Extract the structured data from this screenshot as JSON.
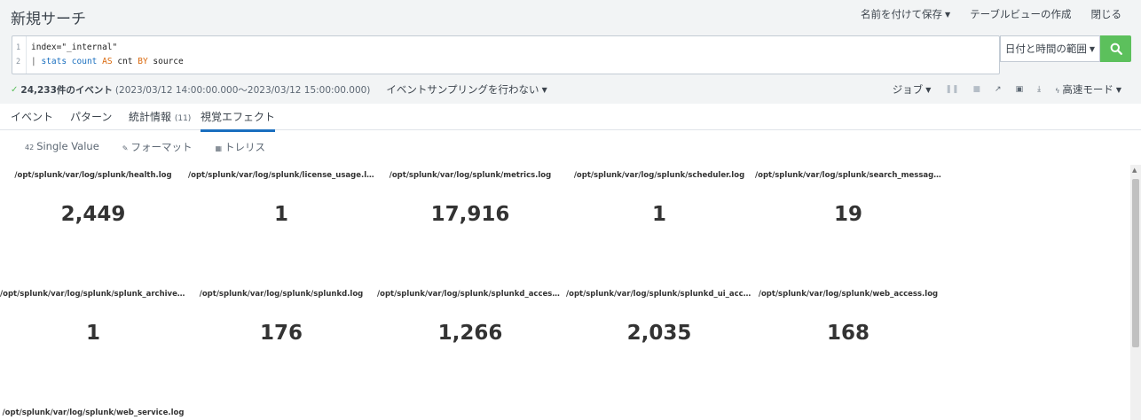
{
  "header": {
    "title": "新規サーチ",
    "save_as": "名前を付けて保存",
    "table_view": "テーブルビューの作成",
    "close": "閉じる"
  },
  "search": {
    "line1_no": "1",
    "line2_no": "2",
    "line1_text": "index=\"_internal\"",
    "line2_pipe": "| ",
    "line2_stats": "stats",
    "line2_count": "count",
    "line2_as": "AS",
    "line2_cnt": "cnt",
    "line2_by": "BY",
    "line2_source": "source",
    "time_range_label": "日付と時間の範囲"
  },
  "status": {
    "event_count": "24,233件のイベント",
    "time_range": "(2023/03/12 14:00:00.000～2023/03/12 15:00:00.000)",
    "sampling": "イベントサンプリングを行わない",
    "job": "ジョブ",
    "mode": "高速モード"
  },
  "tabs": {
    "events": "イベント",
    "patterns": "パターン",
    "statistics": "統計情報",
    "statistics_count": "(11)",
    "visualization": "視覚エフェクト"
  },
  "viz_toolbar": {
    "single_value": "Single Value",
    "format": "フォーマット",
    "trellis": "トレリス"
  },
  "trellis": [
    {
      "label": "/opt/splunk/var/log/splunk/health.log",
      "value": "2,449"
    },
    {
      "label": "/opt/splunk/var/log/splunk/license_usage.log",
      "value": "1"
    },
    {
      "label": "/opt/splunk/var/log/splunk/metrics.log",
      "value": "17,916"
    },
    {
      "label": "/opt/splunk/var/log/splunk/scheduler.log",
      "value": "1"
    },
    {
      "label": "/opt/splunk/var/log/splunk/search_message...",
      "value": "19"
    },
    {
      "label": "/opt/splunk/var/log/splunk/splunk_archiver.log",
      "value": "1"
    },
    {
      "label": "/opt/splunk/var/log/splunk/splunkd.log",
      "value": "176"
    },
    {
      "label": "/opt/splunk/var/log/splunk/splunkd_access.l...",
      "value": "1,266"
    },
    {
      "label": "/opt/splunk/var/log/splunk/splunkd_ui_acce...",
      "value": "2,035"
    },
    {
      "label": "/opt/splunk/var/log/splunk/web_access.log",
      "value": "168"
    },
    {
      "label": "/opt/splunk/var/log/splunk/web_service.log",
      "value": ""
    }
  ],
  "colors": {
    "accent": "#1a6fbf",
    "search_button": "#5cc05c",
    "keyword_orange": "#d9670a"
  }
}
